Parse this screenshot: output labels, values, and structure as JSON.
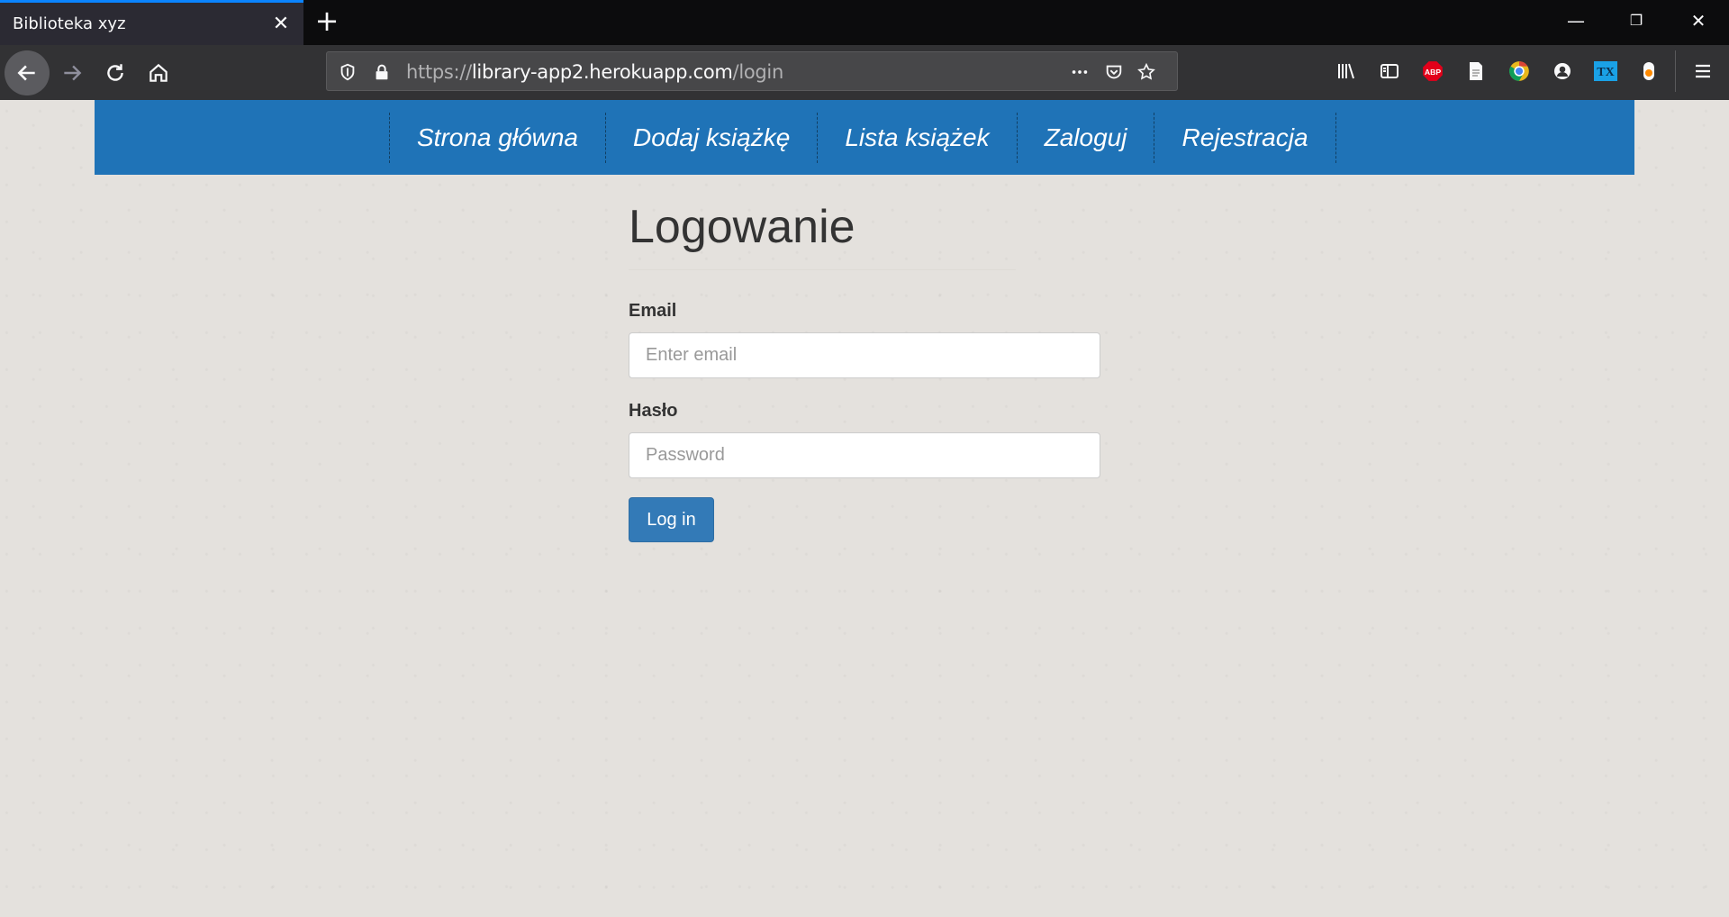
{
  "browser": {
    "tab_title": "Biblioteka xyz",
    "url_scheme": "https://",
    "url_host": "library-app2.herokuapp.com",
    "url_path": "/login",
    "toolbar_icons": [
      "library-icon",
      "sidebar-icon",
      "adblock-icon",
      "reader-icon",
      "chrome-extension-icon",
      "account-icon",
      "translate-icon",
      "extension-icon",
      "menu-icon"
    ],
    "abp_label": "ABP",
    "tx_label": "TX"
  },
  "site": {
    "nav": [
      "Strona główna",
      "Dodaj książkę",
      "Lista książek",
      "Zaloguj",
      "Rejestracja"
    ],
    "heading": "Logowanie",
    "email_label": "Email",
    "email_placeholder": "Enter email",
    "password_label": "Hasło",
    "password_placeholder": "Password",
    "login_button": "Log in"
  },
  "colors": {
    "nav_bg": "#1f73b7",
    "button_bg": "#337ab7",
    "page_bg": "#e4e1dd"
  }
}
